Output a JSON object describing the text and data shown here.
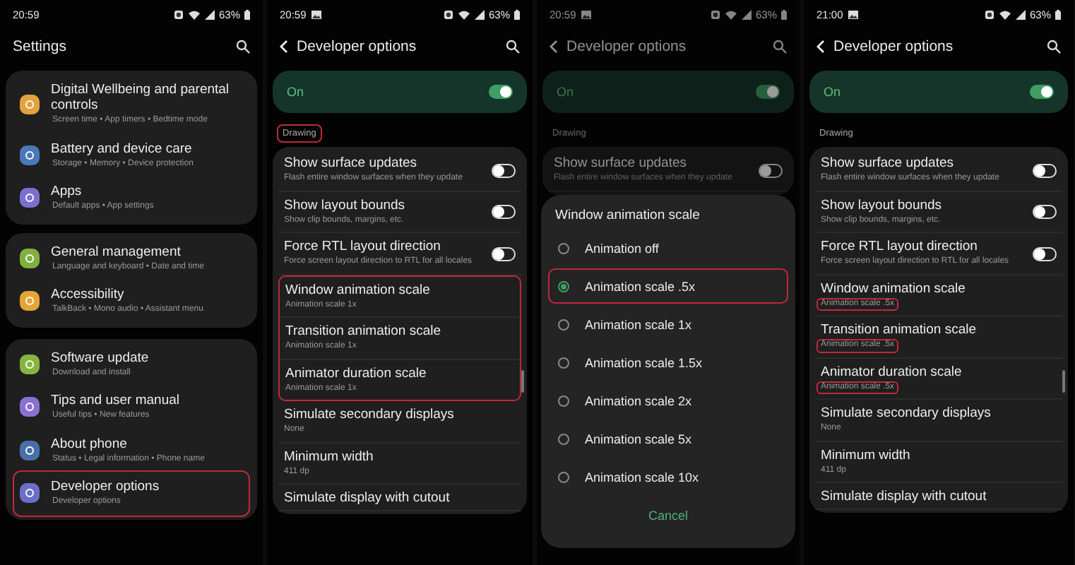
{
  "screens": [
    {
      "kind": "settings",
      "status": {
        "time": "20:59",
        "battery": "63%",
        "photo_notification": false
      },
      "header": {
        "title": "Settings",
        "back": false
      },
      "groups": [
        {
          "items": [
            {
              "title": "Digital Wellbeing and parental controls",
              "subtitle": "Screen time  •  App timers  •  Bedtime mode",
              "color": "#e2a23c",
              "highlighted": false
            },
            {
              "title": "Battery and device care",
              "subtitle": "Storage  •  Memory  •  Device protection",
              "color": "#4a78b8",
              "highlighted": false
            },
            {
              "title": "Apps",
              "subtitle": "Default apps  •  App settings",
              "color": "#7b6fd0",
              "highlighted": false
            }
          ]
        },
        {
          "items": [
            {
              "title": "General management",
              "subtitle": "Language and keyboard  •  Date and time",
              "color": "#7fb040",
              "highlighted": false
            },
            {
              "title": "Accessibility",
              "subtitle": "TalkBack  •  Mono audio  •  Assistant menu",
              "color": "#e3a535",
              "highlighted": false
            }
          ]
        },
        {
          "items": [
            {
              "title": "Software update",
              "subtitle": "Download and install",
              "color": "#86b43f",
              "highlighted": false
            },
            {
              "title": "Tips and user manual",
              "subtitle": "Useful tips  •  New features",
              "color": "#8b70d2",
              "highlighted": false
            },
            {
              "title": "About phone",
              "subtitle": "Status  •  Legal information  •  Phone name",
              "color": "#4a6fa8",
              "highlighted": false
            },
            {
              "title": "Developer options",
              "subtitle": "Developer options",
              "color": "#6b6fc9",
              "highlighted": true
            }
          ]
        }
      ]
    },
    {
      "kind": "developer_options",
      "dimmed": false,
      "status": {
        "time": "20:59",
        "battery": "63%",
        "photo_notification": true
      },
      "header": {
        "title": "Developer options",
        "back": true
      },
      "master": {
        "label": "On",
        "on": true
      },
      "section": {
        "label": "Drawing",
        "highlighted": true
      },
      "rows": [
        {
          "kind": "switch",
          "title": "Show surface updates",
          "subtitle": "Flash entire window surfaces when they update",
          "on": false,
          "highlighted": false,
          "subtitle_highlighted": false
        },
        {
          "kind": "switch",
          "title": "Show layout bounds",
          "subtitle": "Show clip bounds, margins, etc.",
          "on": false,
          "highlighted": false,
          "subtitle_highlighted": false
        },
        {
          "kind": "switch",
          "title": "Force RTL layout direction",
          "subtitle": "Force screen layout direction to RTL for all locales",
          "on": false,
          "highlighted": false,
          "subtitle_highlighted": false
        },
        {
          "kind": "value",
          "title": "Window animation scale",
          "subtitle": "Animation scale 1x",
          "highlighted": true,
          "subtitle_highlighted": false
        },
        {
          "kind": "value",
          "title": "Transition animation scale",
          "subtitle": "Animation scale 1x",
          "highlighted": true,
          "subtitle_highlighted": false
        },
        {
          "kind": "value",
          "title": "Animator duration scale",
          "subtitle": "Animation scale 1x",
          "highlighted": true,
          "subtitle_highlighted": false
        },
        {
          "kind": "value",
          "title": "Simulate secondary displays",
          "subtitle": "None",
          "highlighted": false,
          "subtitle_highlighted": false
        },
        {
          "kind": "value",
          "title": "Minimum width",
          "subtitle": "411 dp",
          "highlighted": false,
          "subtitle_highlighted": false
        },
        {
          "kind": "value",
          "title": "Simulate display with cutout",
          "highlighted": false
        }
      ]
    },
    {
      "kind": "developer_options",
      "dimmed": true,
      "status": {
        "time": "20:59",
        "battery": "63%",
        "photo_notification": true
      },
      "header": {
        "title": "Developer options",
        "back": true
      },
      "master": {
        "label": "On",
        "on": true
      },
      "section": {
        "label": "Drawing",
        "highlighted": false
      },
      "rows": [
        {
          "kind": "switch",
          "title": "Show surface updates",
          "subtitle": "Flash entire window surfaces when they update",
          "on": false,
          "highlighted": false,
          "subtitle_highlighted": false
        }
      ],
      "dialog": {
        "title": "Window animation scale",
        "cancel": "Cancel",
        "options": [
          {
            "label": "Animation off",
            "selected": false,
            "highlighted": false
          },
          {
            "label": "Animation scale .5x",
            "selected": true,
            "highlighted": true
          },
          {
            "label": "Animation scale 1x",
            "selected": false,
            "highlighted": false
          },
          {
            "label": "Animation scale 1.5x",
            "selected": false,
            "highlighted": false
          },
          {
            "label": "Animation scale 2x",
            "selected": false,
            "highlighted": false
          },
          {
            "label": "Animation scale 5x",
            "selected": false,
            "highlighted": false
          },
          {
            "label": "Animation scale 10x",
            "selected": false,
            "highlighted": false
          }
        ]
      }
    },
    {
      "kind": "developer_options",
      "dimmed": false,
      "status": {
        "time": "21:00",
        "battery": "63%",
        "photo_notification": true
      },
      "header": {
        "title": "Developer options",
        "back": true
      },
      "master": {
        "label": "On",
        "on": true
      },
      "section": {
        "label": "Drawing",
        "highlighted": false
      },
      "rows": [
        {
          "kind": "switch",
          "title": "Show surface updates",
          "subtitle": "Flash entire window surfaces when they update",
          "on": false,
          "highlighted": false,
          "subtitle_highlighted": false
        },
        {
          "kind": "switch",
          "title": "Show layout bounds",
          "subtitle": "Show clip bounds, margins, etc.",
          "on": false,
          "highlighted": false,
          "subtitle_highlighted": false
        },
        {
          "kind": "switch",
          "title": "Force RTL layout direction",
          "subtitle": "Force screen layout direction to RTL for all locales",
          "on": false,
          "highlighted": false,
          "subtitle_highlighted": false
        },
        {
          "kind": "value",
          "title": "Window animation scale",
          "subtitle": "Animation scale .5x",
          "highlighted": false,
          "subtitle_highlighted": true
        },
        {
          "kind": "value",
          "title": "Transition animation scale",
          "subtitle": "Animation scale .5x",
          "highlighted": false,
          "subtitle_highlighted": true
        },
        {
          "kind": "value",
          "title": "Animator duration scale",
          "subtitle": "Animation scale .5x",
          "highlighted": false,
          "subtitle_highlighted": true
        },
        {
          "kind": "value",
          "title": "Simulate secondary displays",
          "subtitle": "None",
          "highlighted": false,
          "subtitle_highlighted": false
        },
        {
          "kind": "value",
          "title": "Minimum width",
          "subtitle": "411 dp",
          "highlighted": false,
          "subtitle_highlighted": false
        },
        {
          "kind": "value",
          "title": "Simulate display with cutout",
          "highlighted": false
        }
      ]
    }
  ]
}
